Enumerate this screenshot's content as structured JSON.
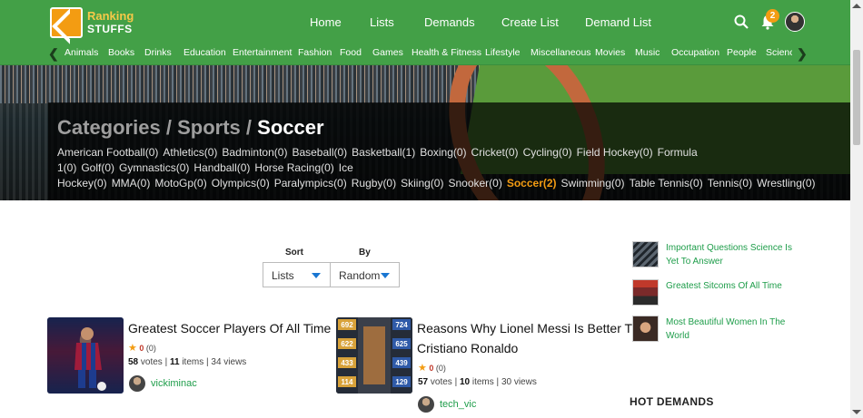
{
  "brand": {
    "line1": "Ranking",
    "line2": "STUFFS"
  },
  "nav": [
    "Home",
    "Lists",
    "Demands",
    "Create List",
    "Demand List"
  ],
  "notifications": {
    "count": "2"
  },
  "categories": [
    "Animals",
    "Books",
    "Drinks",
    "Education",
    "Entertainment",
    "Fashion",
    "Food",
    "Games",
    "Health & Fitness",
    "Lifestyle",
    "Miscellaneous",
    "Movies",
    "Music",
    "Occupation",
    "People",
    "Science"
  ],
  "breadcrumb": {
    "root": "Categories",
    "sep": "/",
    "parent": "Sports",
    "current": "Soccer"
  },
  "subcategories": [
    "American Football(0)",
    "Athletics(0)",
    "Badminton(0)",
    "Baseball(0)",
    "Basketball(1)",
    "Boxing(0)",
    "Cricket(0)",
    "Cycling(0)",
    "Field Hockey(0)",
    "Formula 1(0)",
    "Golf(0)",
    "Gymnastics(0)",
    "Handball(0)",
    "Horse Racing(0)",
    "Ice Hockey(0)",
    "MMA(0)",
    "MotoGp(0)",
    "Olympics(0)",
    "Paralympics(0)",
    "Rugby(0)",
    "Skiing(0)",
    "Snooker(0)",
    "Soccer(2)",
    "Swimming(0)",
    "Table Tennis(0)",
    "Tennis(0)",
    "Wrestling(0)"
  ],
  "active_subcategory": "Soccer(2)",
  "sort": {
    "sort_label": "Sort",
    "by_label": "By",
    "sort_value": "Lists",
    "by_value": "Random"
  },
  "lists": [
    {
      "title_line1": "Greatest Soccer Players Of All Time",
      "title_line2": "",
      "rating": "0",
      "rating_count": "(0)",
      "votes": "58",
      "votes_label": "votes",
      "items": "11",
      "items_label": "items",
      "views": "34 views",
      "author": "vickiminac"
    },
    {
      "title_line1": "Reasons Why Lionel Messi Is Better Than",
      "title_line2": "Cristiano Ronaldo",
      "rating": "0",
      "rating_count": "(0)",
      "votes": "57",
      "votes_label": "votes",
      "items": "10",
      "items_label": "items",
      "views": "30 views",
      "author": "tech_vic"
    }
  ],
  "messi_stats": {
    "left": [
      "692",
      "622",
      "433",
      "114"
    ],
    "right": [
      "724",
      "625",
      "439",
      "129"
    ]
  },
  "sidebar": [
    {
      "line1": "Important Questions Science Is",
      "line2": "Yet To Answer"
    },
    {
      "line1": "Greatest Sitcoms Of All Time",
      "line2": ""
    },
    {
      "line1": "Most Beautiful Women In The",
      "line2": "World"
    }
  ],
  "hot_demands": "HOT DEMANDS"
}
